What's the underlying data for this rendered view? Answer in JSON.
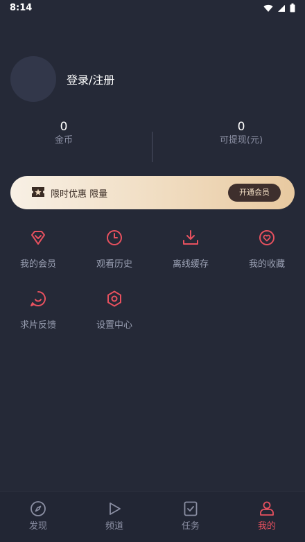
{
  "status_bar": {
    "time": "8:14"
  },
  "profile": {
    "login_label": "登录/注册"
  },
  "stats": [
    {
      "value": "0",
      "label": "金币"
    },
    {
      "value": "0",
      "label": "可提现(元)"
    }
  ],
  "vip_banner": {
    "text": "限时优惠 限量",
    "button_label": "开通会员"
  },
  "menu": [
    {
      "label": "我的会员",
      "icon": "diamond-icon"
    },
    {
      "label": "观看历史",
      "icon": "clock-icon"
    },
    {
      "label": "离线缓存",
      "icon": "download-icon"
    },
    {
      "label": "我的收藏",
      "icon": "heart-icon"
    },
    {
      "label": "求片反馈",
      "icon": "chat-icon"
    },
    {
      "label": "设置中心",
      "icon": "settings-icon"
    }
  ],
  "tabs": [
    {
      "label": "发现",
      "icon": "compass-icon",
      "active": false
    },
    {
      "label": "频道",
      "icon": "play-icon",
      "active": false
    },
    {
      "label": "任务",
      "icon": "task-icon",
      "active": false
    },
    {
      "label": "我的",
      "icon": "user-icon",
      "active": true
    }
  ],
  "colors": {
    "background": "#252937",
    "accent": "#e8515f",
    "muted": "#9aa0b3",
    "vip_gold": "#e8c9a0"
  }
}
